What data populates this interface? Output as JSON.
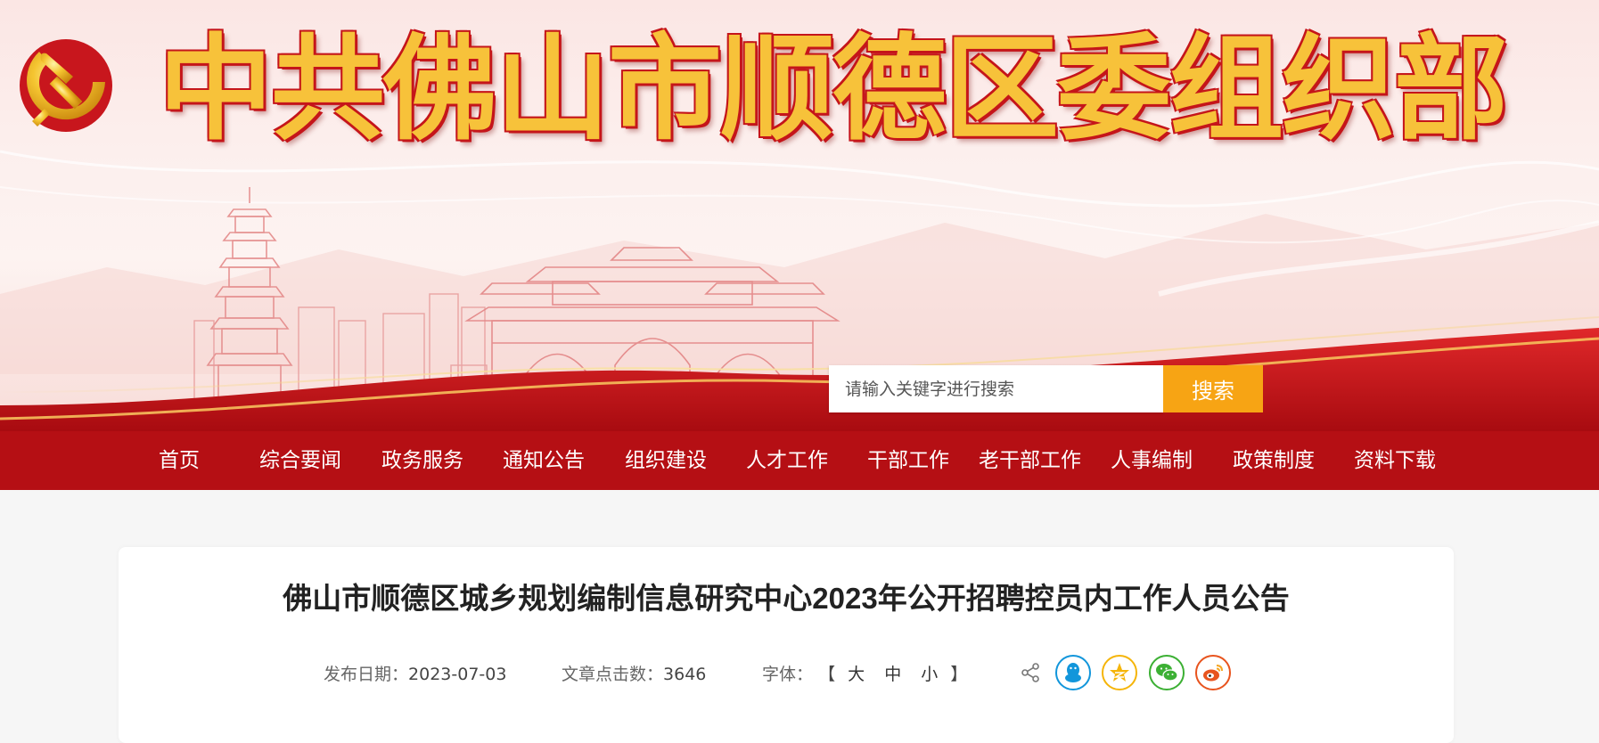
{
  "header": {
    "site_title": "中共佛山市顺德区委组织部",
    "emblem_icon": "party-emblem-icon"
  },
  "search": {
    "placeholder": "请输入关键字进行搜索",
    "button_label": "搜索"
  },
  "nav": {
    "items": [
      {
        "label": "首页"
      },
      {
        "label": "综合要闻"
      },
      {
        "label": "政务服务"
      },
      {
        "label": "通知公告"
      },
      {
        "label": "组织建设"
      },
      {
        "label": "人才工作"
      },
      {
        "label": "干部工作"
      },
      {
        "label": "老干部工作"
      },
      {
        "label": "人事编制"
      },
      {
        "label": "政策制度"
      },
      {
        "label": "资料下载"
      }
    ]
  },
  "article": {
    "title": "佛山市顺德区城乡规划编制信息研究中心2023年公开招聘控员内工作人员公告",
    "publish_label": "发布日期：",
    "publish_date": "2023-07-03",
    "views_label": "文章点击数：",
    "views": "3646",
    "font_label": "字体：",
    "bracket_open": "【",
    "font_large": "大",
    "font_medium": "中",
    "font_small": "小",
    "bracket_close": "】"
  },
  "share": {
    "icons": [
      "share-icon",
      "qq-icon",
      "qzone-icon",
      "wechat-icon",
      "weibo-icon"
    ]
  },
  "colors": {
    "nav_bg": "#b50f14",
    "search_button": "#f7a414",
    "title_gold": "#f7c23a",
    "title_red": "#c5151a",
    "qq": "#1296db",
    "qzone": "#f5b50a",
    "wechat": "#3cb034",
    "weibo": "#e8541e"
  }
}
